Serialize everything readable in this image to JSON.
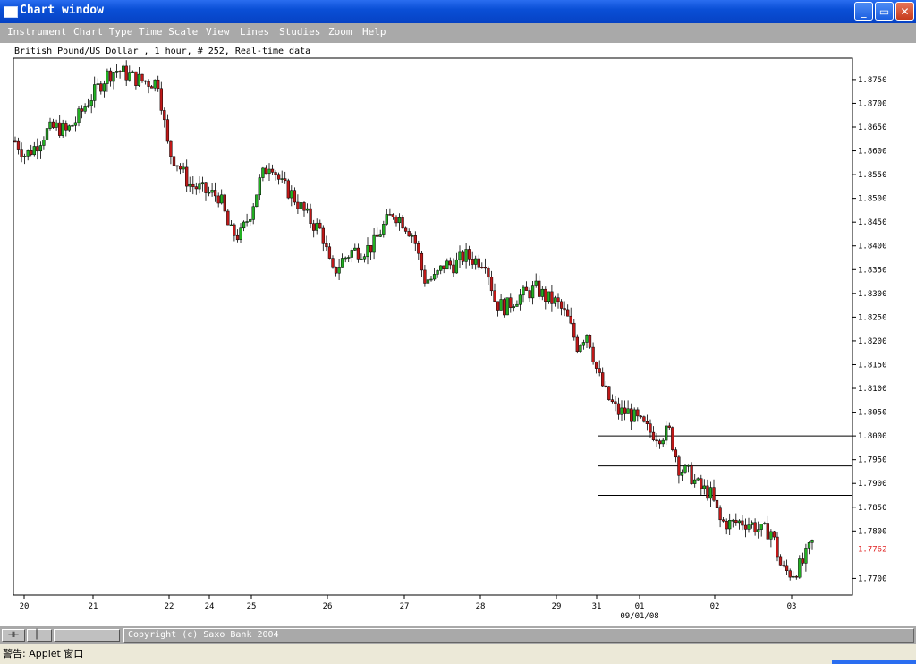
{
  "window": {
    "title": "Chart window",
    "min_label": "_",
    "max_label": "▭",
    "close_label": "✕"
  },
  "menu": [
    "Instrument",
    "Chart Type",
    "Time Scale",
    "View",
    "Lines",
    "Studies",
    "Zoom",
    "Help"
  ],
  "chart_data": {
    "type": "candlestick",
    "caption": "British Pound/US Dollar , 1 hour, # 252, Real-time data",
    "ylim": [
      1.7665,
      1.8795
    ],
    "y_ticks": [
      "1.8750",
      "1.8700",
      "1.8650",
      "1.8600",
      "1.8550",
      "1.8500",
      "1.8450",
      "1.8400",
      "1.8350",
      "1.8300",
      "1.8250",
      "1.8200",
      "1.8150",
      "1.8100",
      "1.8050",
      "1.8000",
      "1.7950",
      "1.7900",
      "1.7850",
      "1.7800",
      "1.7700"
    ],
    "x_ticks": [
      "20",
      "21",
      "22",
      "24",
      "25",
      "26",
      "27",
      "28",
      "29",
      "31",
      "01",
      "02",
      "03"
    ],
    "x_date_label": "09/01/08",
    "current_price": "1.7762",
    "horizontal_lines": [
      1.8,
      1.7937,
      1.7875
    ],
    "close_path": [
      1.862,
      1.859,
      1.861,
      1.864,
      1.865,
      1.864,
      1.8665,
      1.87,
      1.873,
      1.876,
      1.877,
      1.876,
      1.875,
      1.8745,
      1.8745,
      1.86,
      1.857,
      1.853,
      1.852,
      1.851,
      1.8505,
      1.843,
      1.842,
      1.847,
      1.854,
      1.858,
      1.853,
      1.851,
      1.848,
      1.845,
      1.843,
      1.834,
      1.837,
      1.839,
      1.839,
      1.84,
      1.844,
      1.847,
      1.845,
      1.842,
      1.833,
      1.833,
      1.836,
      1.836,
      1.838,
      1.837,
      1.837,
      1.828,
      1.827,
      1.829,
      1.83,
      1.831,
      1.829,
      1.828,
      1.825,
      1.819,
      1.822,
      1.813,
      1.808,
      1.805,
      1.805,
      1.803,
      1.801,
      1.8,
      1.801,
      1.793,
      1.792,
      1.789,
      1.788,
      1.782,
      1.7815,
      1.782,
      1.7815,
      1.78,
      1.78,
      1.772,
      1.771,
      1.773,
      1.7775
    ]
  },
  "toolbar": {
    "btn1": "⊣⊢",
    "btn2": "┼─"
  },
  "status": {
    "copyright": "Copyright (c) Saxo Bank 2004"
  },
  "warning": {
    "text": "警告: Applet 窗口"
  }
}
